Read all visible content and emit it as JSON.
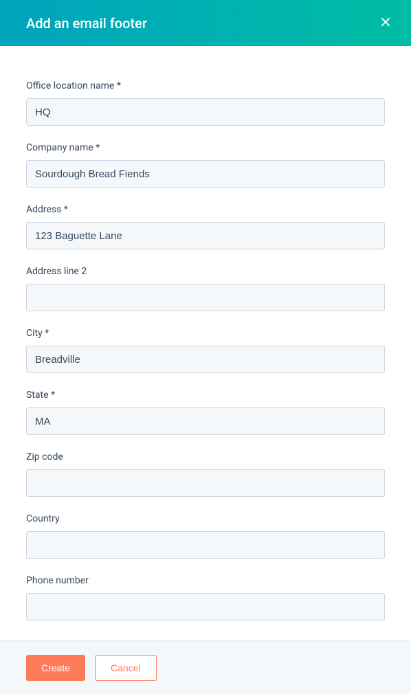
{
  "header": {
    "title": "Add an email footer"
  },
  "form": {
    "fields": [
      {
        "label": "Office location name *",
        "value": "HQ",
        "name": "office-location-name-input"
      },
      {
        "label": "Company name *",
        "value": "Sourdough Bread Fiends",
        "name": "company-name-input"
      },
      {
        "label": "Address *",
        "value": "123 Baguette Lane",
        "name": "address-input"
      },
      {
        "label": "Address line 2",
        "value": "",
        "name": "address-line-2-input"
      },
      {
        "label": "City *",
        "value": "Breadville",
        "name": "city-input"
      },
      {
        "label": "State *",
        "value": "MA",
        "name": "state-input"
      },
      {
        "label": "Zip code",
        "value": "",
        "name": "zip-code-input"
      },
      {
        "label": "Country",
        "value": "",
        "name": "country-input"
      },
      {
        "label": "Phone number",
        "value": "",
        "name": "phone-number-input"
      }
    ]
  },
  "footer": {
    "create_label": "Create",
    "cancel_label": "Cancel"
  }
}
